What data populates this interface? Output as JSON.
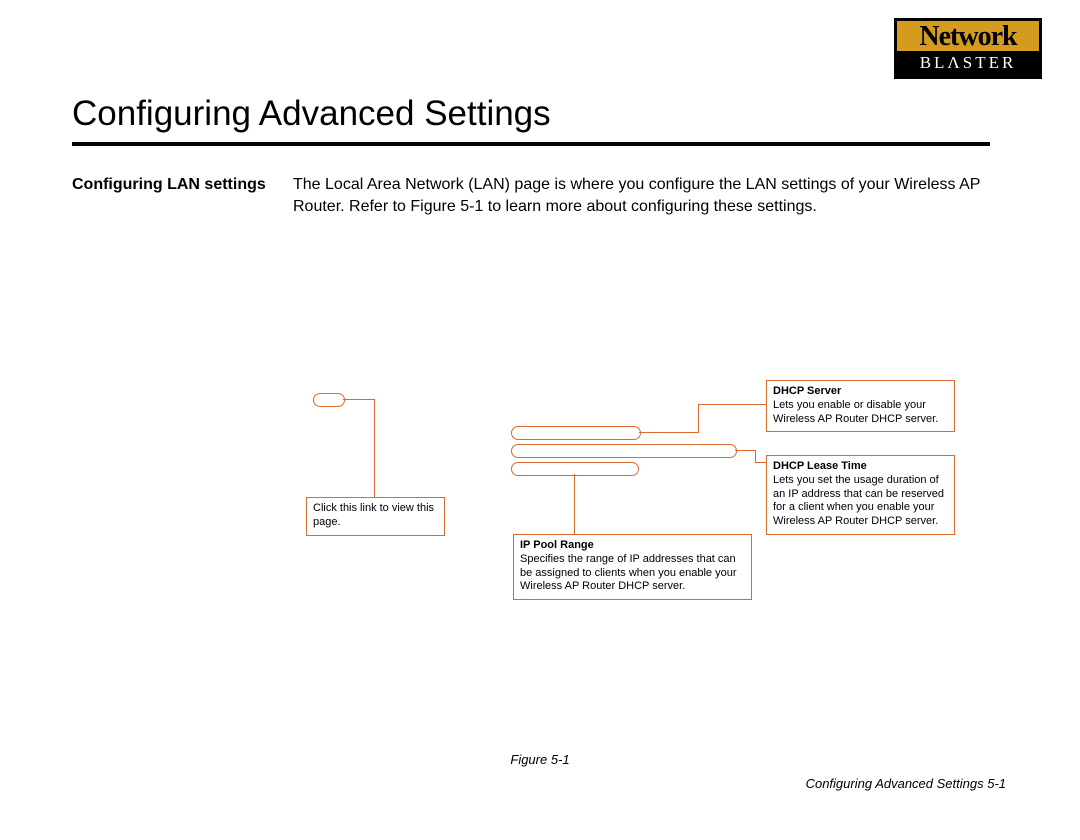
{
  "logo": {
    "top": "Network",
    "bottom": "BLΛSTER"
  },
  "title": "Configuring Advanced Settings",
  "section": {
    "heading": "Configuring LAN settings",
    "body": "The Local Area Network (LAN) page is where you configure the LAN settings of your Wireless AP Router. Refer to Figure 5-1 to learn more about configuring these settings."
  },
  "callouts": {
    "link_hint": "Click this link to view this page.",
    "dhcp_server": {
      "title": "DHCP Server",
      "txt": "Lets you enable or disable your Wireless AP Router DHCP server."
    },
    "dhcp_lease": {
      "title": "DHCP Lease Time",
      "txt": "Lets you set the usage duration of an IP address that can be reserved for a client when you enable your Wireless AP Router DHCP server."
    },
    "ip_pool": {
      "title": "IP Pool Range",
      "txt": "Specifies the range of IP addresses that can be assigned to clients when you enable your Wireless AP Router DHCP server."
    }
  },
  "figure_caption": "Figure 5-1",
  "footer": "Configuring Advanced Settings  5-1"
}
